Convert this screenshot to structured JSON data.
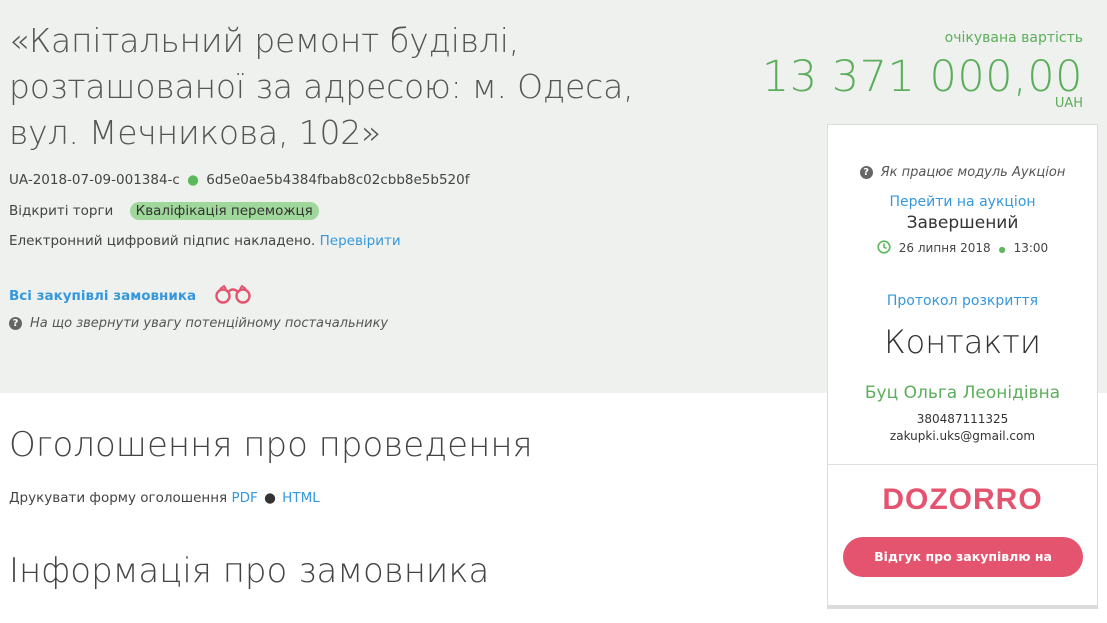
{
  "tender": {
    "title": "«Капітальний ремонт будівлі, розташованої за адресою: м. Одеса, вул. Мечникова, 102»",
    "id": "UA-2018-07-09-001384-c",
    "hash": "6d5e0ae5b4384fbab8c02cbb8e5b520f",
    "procedure": "Відкриті торги",
    "status_badge": "Кваліфікація переможця",
    "signature_text": "Електронний цифровий підпис накладено.",
    "signature_link": "Перевірити",
    "all_purchases_link": "Всі закупівлі замовника",
    "supplier_note": "На що звернути увагу потенційному постачальнику"
  },
  "price": {
    "label": "очікувана вартість",
    "amount": "13 371 000,00",
    "currency": "UAH"
  },
  "panel": {
    "auction_help": "Як працює модуль Аукціон",
    "auction_link": "Перейти на аукціон",
    "auction_status": "Завершений",
    "auction_date": "26 липня 2018",
    "auction_time": "13:00",
    "protocol_link": "Протокол розкриття",
    "contacts_title": "Контакти",
    "contact_name": "Буц Ольга Леонідівна",
    "contact_phone": "380487111325",
    "contact_email": "zakupki.uks@gmail.com",
    "dozorro_logo": "DOZORRO",
    "dozorro_button": "Відгук про закупівлю на Дозорро"
  },
  "sections": {
    "announcement_title": "Оголошення про проведення",
    "print_label": "Друкувати форму оголошення",
    "print_pdf": "PDF",
    "print_html": "HTML",
    "customer_title": "Інформація про замовника"
  },
  "colors": {
    "accent_green": "#5cae5c",
    "link_blue": "#3598dc",
    "dozorro_red": "#e4546f",
    "hero_bg": "#eef1ee"
  }
}
